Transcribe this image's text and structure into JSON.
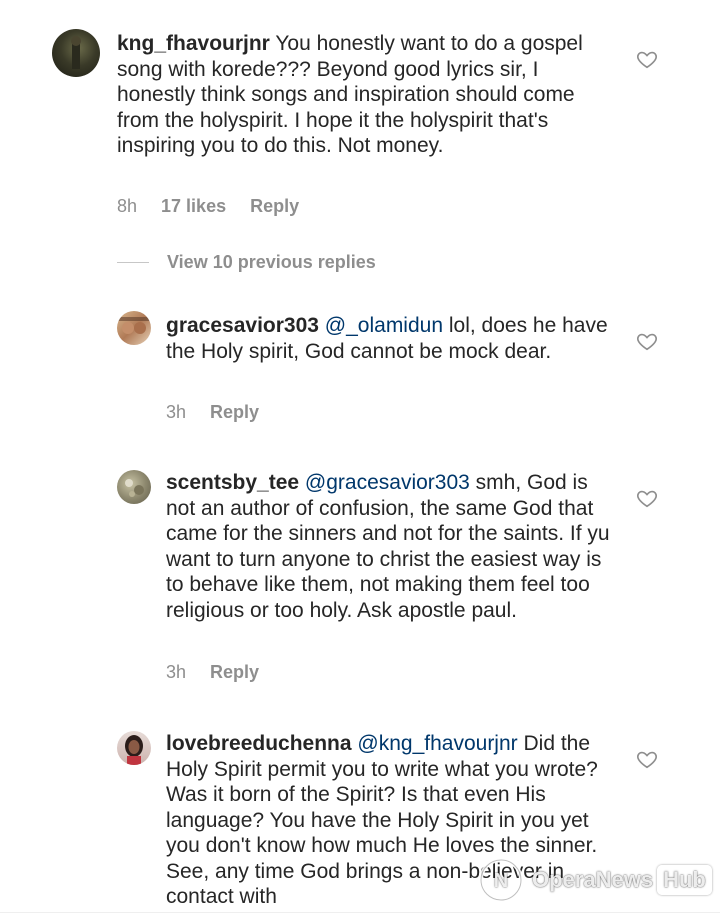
{
  "comments": [
    {
      "username": "kng_fhavourjnr",
      "mention": "",
      "text": "You honestly want to do a gospel song with korede??? Beyond good lyrics sir, I honestly think songs and inspiration should come from the holyspirit. I hope it the holyspirit that's inspiring you to do this. Not money.",
      "time": "8h",
      "likes": "17 likes",
      "reply": "Reply"
    },
    {
      "username": "gracesavior303",
      "mention": "@_olamidun",
      "text": "lol, does he have the Holy spirit, God cannot be mock dear.",
      "time": "3h",
      "reply": "Reply"
    },
    {
      "username": "scentsby_tee",
      "mention": "@gracesavior303",
      "text": "smh, God is not an author of confusion, the same God that came for the sinners and not for the saints. If yu want to turn anyone to christ the easiest way is to behave like them,  not making them feel too religious or too holy. Ask apostle paul.",
      "time": "3h",
      "reply": "Reply"
    },
    {
      "username": "lovebreeduchenna",
      "mention": "@kng_fhavourjnr",
      "text": "Did the Holy Spirit permit you to write what you wrote? Was it born of the Spirit? Is that even His language? You have the Holy Spirit in you yet you don't know how much He loves the sinner. See, any time God brings a non-believer in contact with"
    }
  ],
  "view_replies": "View 10 previous replies",
  "watermark": {
    "brand": "OperaNews",
    "hub": "Hub"
  },
  "colors": {
    "text": "#262626",
    "meta": "#8e8e8e",
    "mention": "#00376b"
  }
}
